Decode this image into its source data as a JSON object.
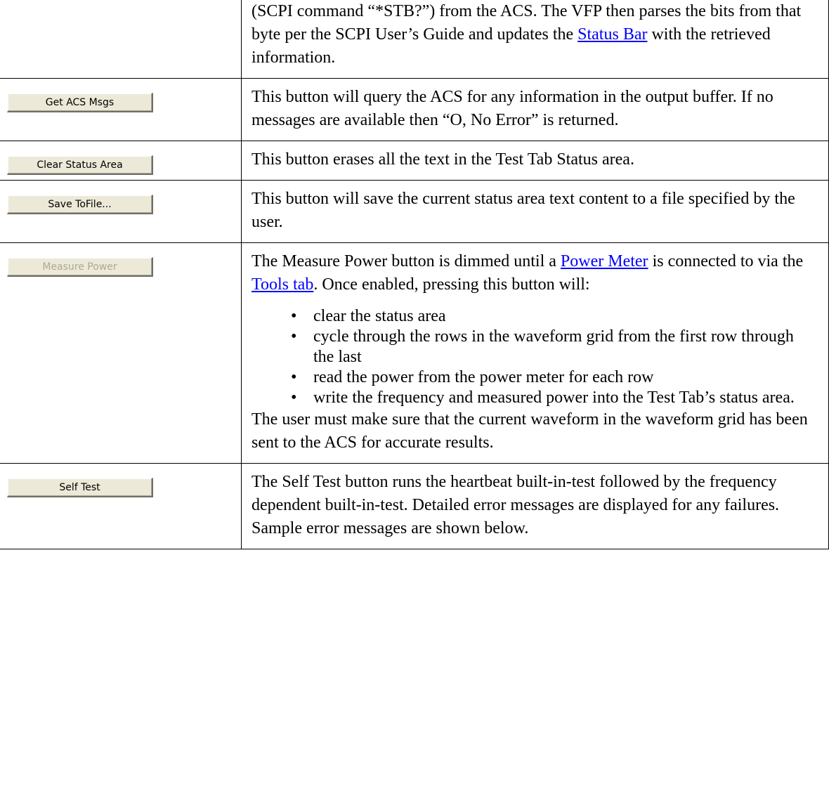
{
  "rows": [
    {
      "button": "",
      "parts": [
        "(SCPI command “*STB?”) from the ACS. The VFP then parses the bits from that byte per the SCPI User’s Guide and updates the ",
        "Status Bar",
        " with the retrieved information."
      ]
    },
    {
      "button": "Get ACS Msgs",
      "text": "This button will query the ACS for any information in the output buffer. If no messages are available then “O, No Error” is returned."
    },
    {
      "button": "Clear Status Area",
      "text": "This button erases all the text in the Test Tab Status area."
    },
    {
      "button": "Save ToFile...",
      "text": "This button will save the current status area text content to a file specified by the user."
    },
    {
      "button": "Measure Power",
      "button_state": "disabled",
      "intro_parts": [
        "The Measure Power button is dimmed until a ",
        "Power Meter",
        " is connected to via the ",
        "Tools tab",
        ". Once enabled, pressing this button will:"
      ],
      "bullets": [
        "clear the status area",
        "cycle through the rows in the waveform grid from the first row through the last",
        "read the power from the power meter for each row",
        "write the frequency and measured power into the Test Tab’s status area."
      ],
      "note": "The user must make sure that the current waveform in the waveform grid has been sent to the ACS for accurate results."
    },
    {
      "button": "Self Test",
      "text": "The Self Test button runs the heartbeat built-in-test followed by the frequency dependent built-in-test. Detailed error messages are displayed for any failures. Sample error messages are shown below."
    }
  ],
  "colors": {
    "link": "#0000ff",
    "button_face": "#ece9d8",
    "button_disabled_text": "#aca899"
  }
}
